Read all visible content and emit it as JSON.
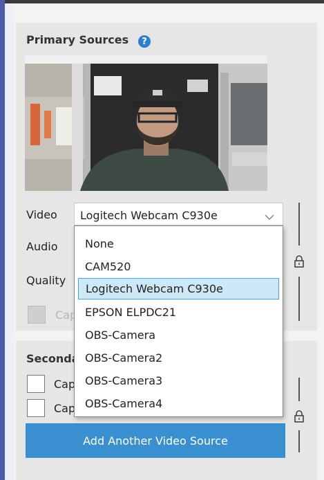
{
  "primary": {
    "title": "Primary Sources",
    "help_icon": "?",
    "video_label": "Video",
    "audio_label": "Audio",
    "quality_label": "Quality",
    "capture_checkbox_label": "Capture",
    "video_select": {
      "selected": "Logitech Webcam C930e"
    },
    "video_options": [
      "None",
      "CAM520",
      "Logitech Webcam C930e",
      "EPSON ELPDC21",
      "OBS-Camera",
      "OBS-Camera2",
      "OBS-Camera3",
      "OBS-Camera4"
    ],
    "selected_option_index": 2
  },
  "secondary": {
    "title": "Secondary Sources",
    "checkbox_1_label": "Capture",
    "checkbox_2_label": "Capture",
    "add_button_label": "Add Another Video Source"
  },
  "icons": {
    "help": "help-icon",
    "lock": "lock-icon",
    "chevron": "chevron-down-icon"
  },
  "colors": {
    "accent": "#3a8fd0",
    "help": "#2f7fd0",
    "selection": "#cde8f6",
    "selection_border": "#4aa3df"
  }
}
